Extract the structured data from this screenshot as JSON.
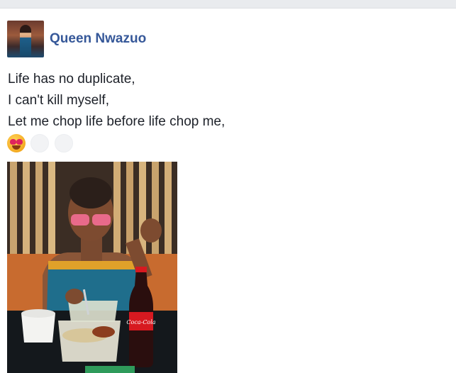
{
  "post": {
    "author_name": "Queen Nwazuo",
    "text_lines": [
      "Life has no duplicate,",
      "I can't kill myself,",
      "Let me chop life before life chop me,"
    ],
    "emojis": [
      "heart-eyes-emoji",
      "blank-emoji",
      "blank-emoji"
    ]
  },
  "photo_labels": {
    "bottle_brand": "Coca-Cola"
  },
  "colors": {
    "author_link": "#365899",
    "text": "#1d2129",
    "page_bg": "#e9ebee",
    "card_bg": "#ffffff"
  }
}
